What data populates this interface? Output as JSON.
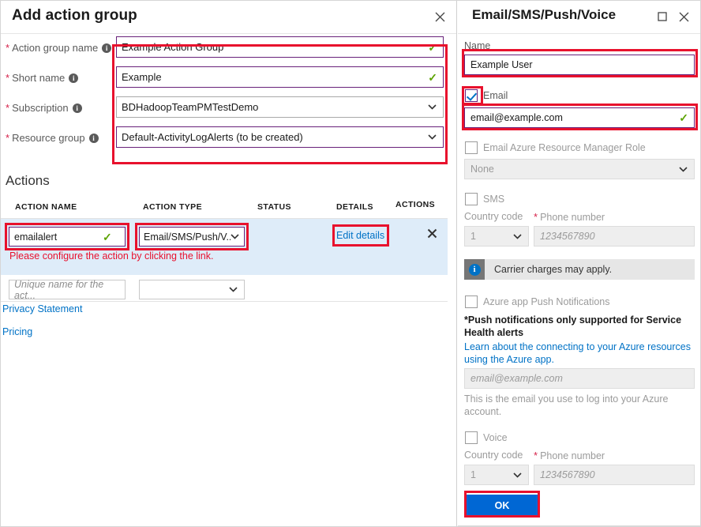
{
  "left_blade": {
    "title": "Add action group",
    "close_icon": "close-icon",
    "fields": [
      {
        "label": "Action group name",
        "required": true,
        "value": "Example Action Group",
        "type": "text",
        "validated": true,
        "info_icon": "info-icon"
      },
      {
        "label": "Short name",
        "required": true,
        "value": "Example",
        "type": "text",
        "validated": true,
        "info_icon": "info-icon"
      },
      {
        "label": "Subscription",
        "required": true,
        "value": "BDHadoopTeamPMTestDemo",
        "type": "select",
        "validated": false,
        "info_icon": "info-icon"
      },
      {
        "label": "Resource group",
        "required": true,
        "value": "Default-ActivityLogAlerts (to be created)",
        "type": "select",
        "validated": false,
        "info_icon": "info-icon"
      }
    ],
    "actions_section": {
      "heading": "Actions",
      "columns": [
        "ACTION NAME",
        "ACTION TYPE",
        "STATUS",
        "DETAILS",
        "ACTIONS"
      ],
      "active_row": {
        "name_value": "emailalert",
        "type_value": "Email/SMS/Push/V...",
        "status_value": "",
        "details_link": "Edit details",
        "remove_icon": "close-icon",
        "error_message": "Please configure the action by clicking the link."
      },
      "empty_row": {
        "name_placeholder": "Unique name for the act...",
        "type_value": ""
      }
    },
    "footer_links": [
      "Privacy Statement",
      "Pricing"
    ]
  },
  "right_blade": {
    "title": "Email/SMS/Push/Voice",
    "maximize_icon": "maximize-icon",
    "close_icon": "close-icon",
    "name": {
      "label": "Name",
      "value": "Example User"
    },
    "email": {
      "checkbox_label": "Email",
      "checked": true,
      "value": "email@example.com",
      "validated": true
    },
    "arm_role": {
      "checkbox_label": "Email Azure Resource Manager Role",
      "checked": false,
      "select_value": "None"
    },
    "sms": {
      "checkbox_label": "SMS",
      "checked": false,
      "country_code_label": "Country code",
      "country_code_value": "1",
      "phone_label": "Phone number",
      "phone_required": true,
      "phone_placeholder": "1234567890"
    },
    "carrier_note": {
      "icon": "info-icon",
      "text": "Carrier charges may apply."
    },
    "push": {
      "checkbox_label": "Azure app Push Notifications",
      "checked": false,
      "bold_note": "*Push notifications only supported for Service Health alerts",
      "link_text": "Learn about the connecting to your Azure resources using the Azure app.",
      "email_placeholder": "email@example.com",
      "hint": "This is the email you use to log into your Azure account."
    },
    "voice": {
      "checkbox_label": "Voice",
      "checked": false,
      "country_code_label": "Country code",
      "country_code_value": "1",
      "phone_label": "Phone number",
      "phone_required": true,
      "phone_placeholder": "1234567890"
    },
    "ok_button": "OK"
  },
  "colors": {
    "accent_blue": "#0072c6",
    "button_blue": "#0067d4",
    "annotation_red": "#e8112d",
    "validated_purple": "#68217a",
    "valid_check_green": "#5ca300",
    "error_red": "#e8112d",
    "row_highlight": "#deecf9"
  }
}
